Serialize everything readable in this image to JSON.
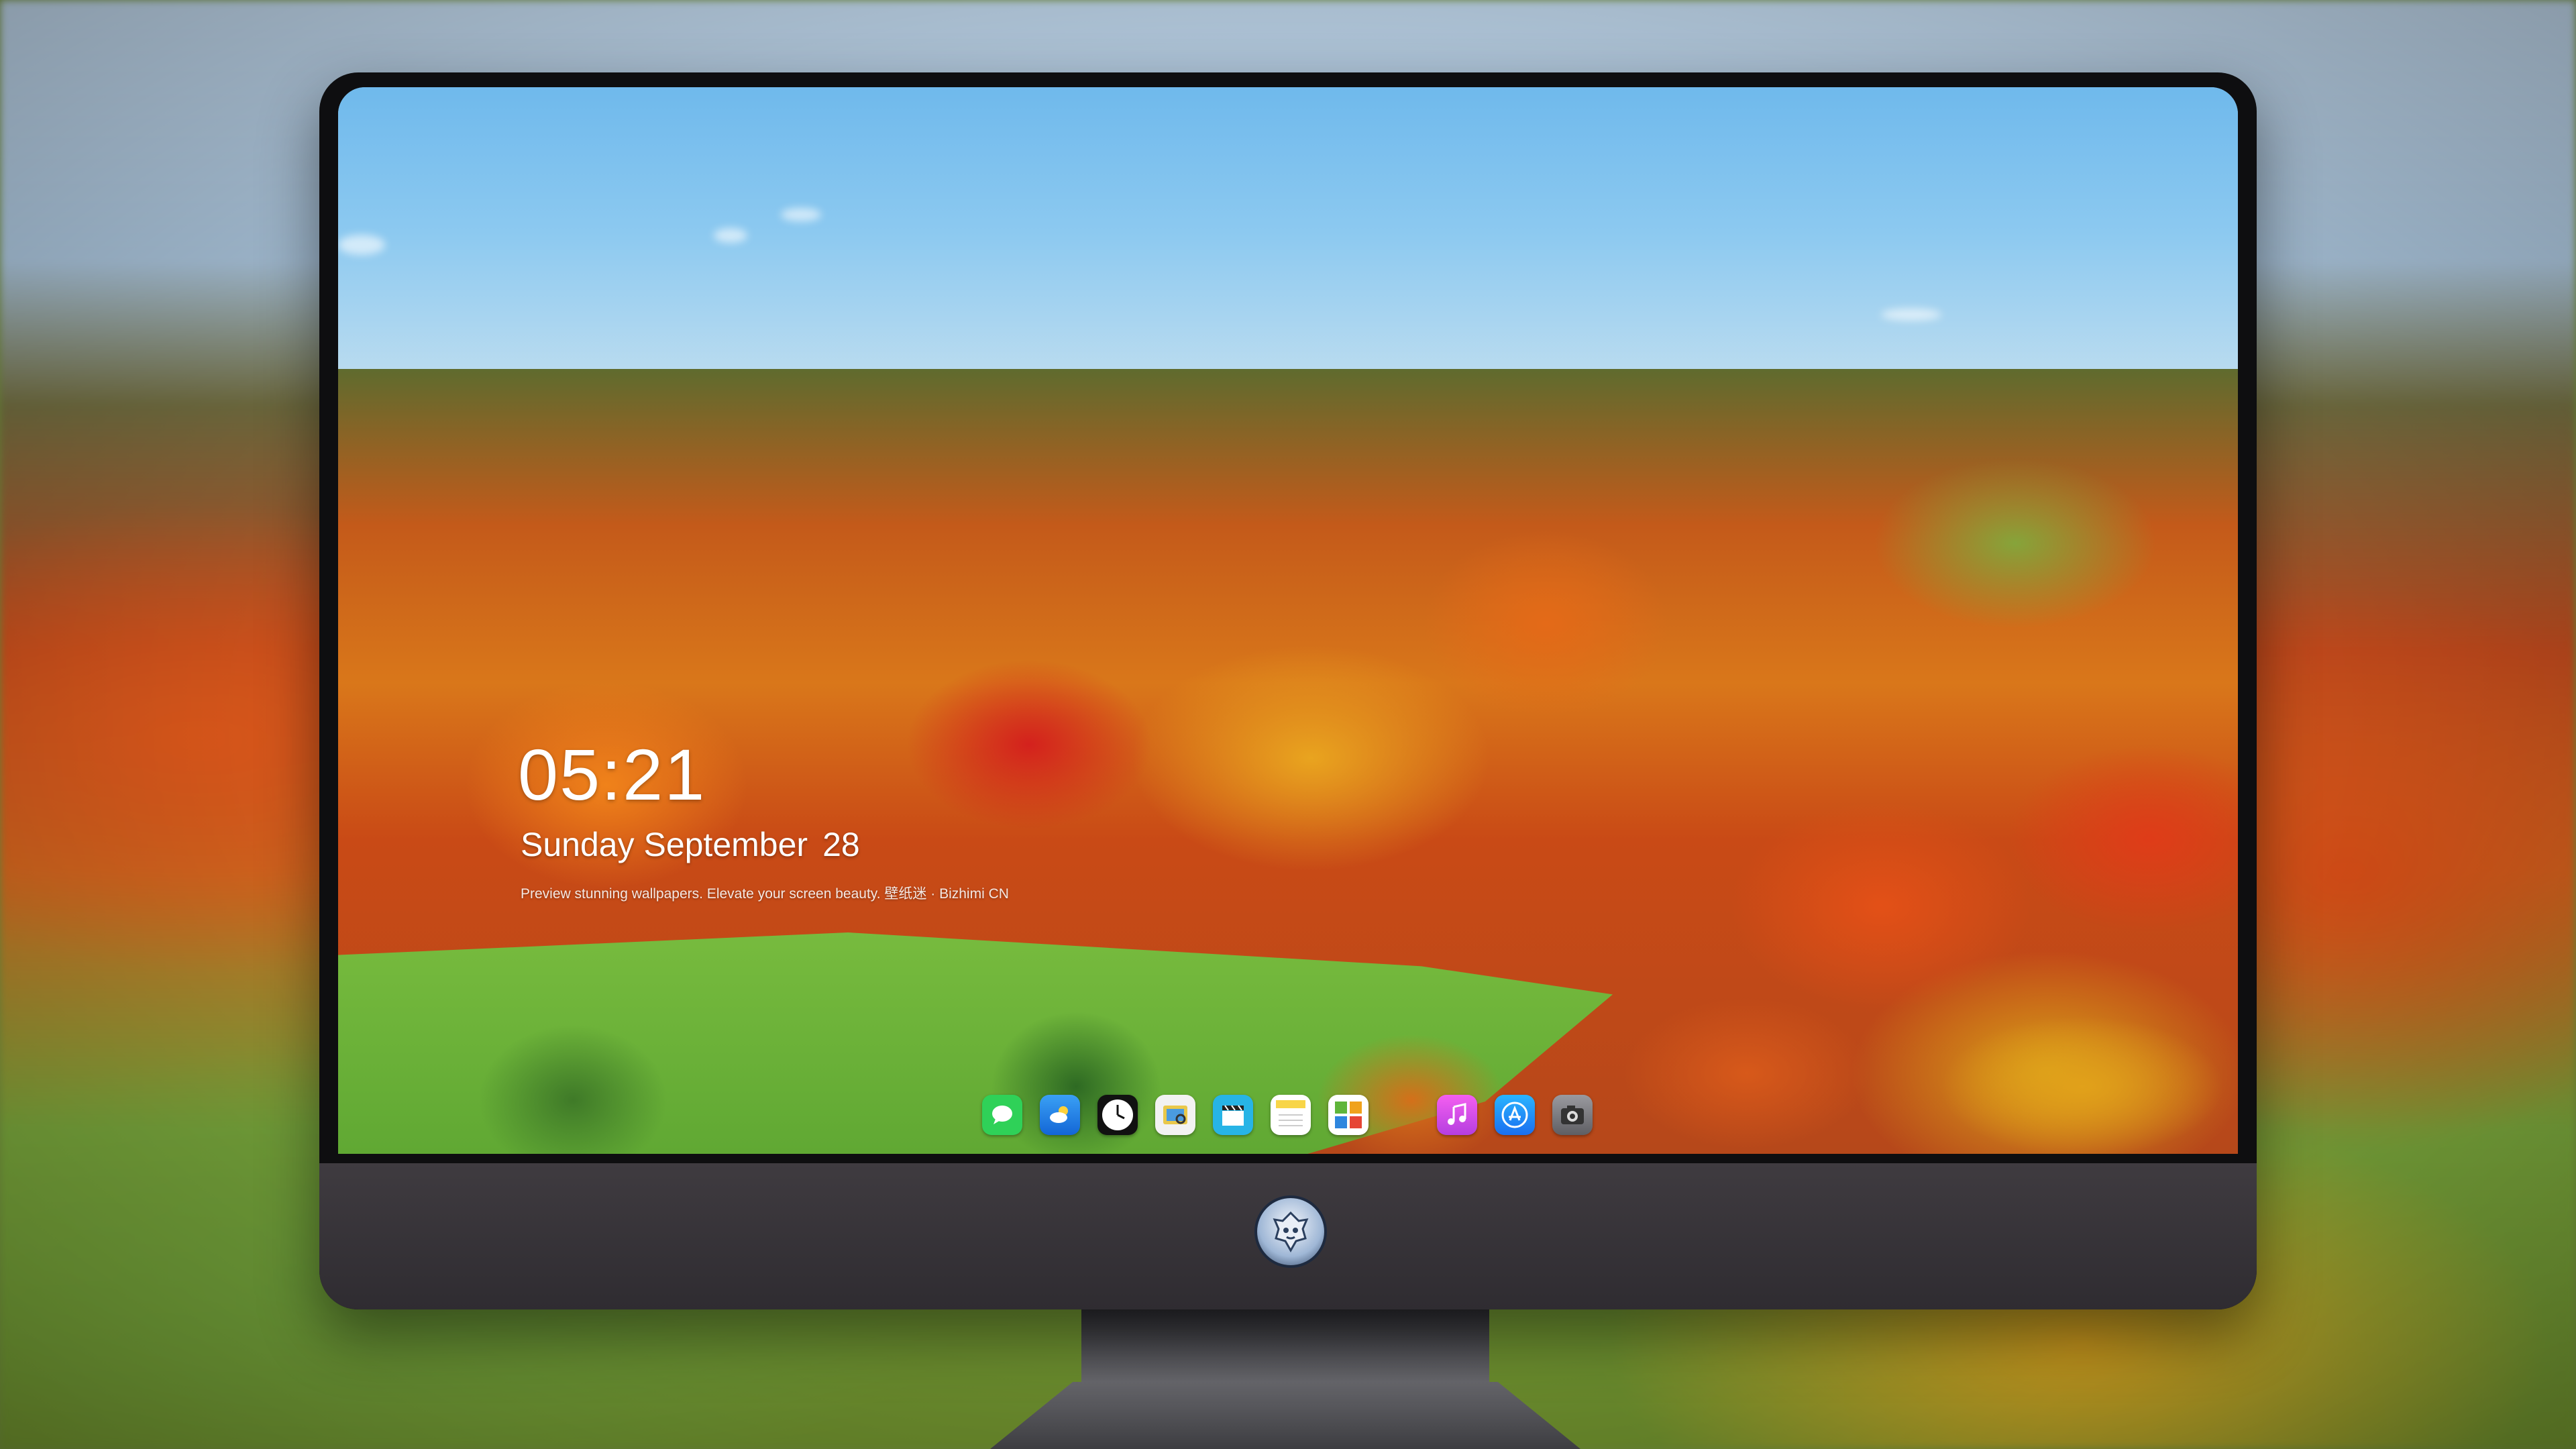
{
  "lock_screen": {
    "time": "05:21",
    "weekday_month": "Sunday September",
    "day": "28",
    "tagline": "Preview stunning wallpapers. Elevate your screen beauty. 壁纸迷 · Bizhimi CN"
  },
  "dock": {
    "apps": [
      {
        "name": "messages",
        "icon": "message-bubble-icon",
        "color": "#2fd158"
      },
      {
        "name": "weather",
        "icon": "cloud-sun-icon",
        "color": "#1e88f0"
      },
      {
        "name": "clock",
        "icon": "clock-icon",
        "color": "#ffffff"
      },
      {
        "name": "preview",
        "icon": "preview-icon",
        "color": "#e9c84a"
      },
      {
        "name": "clips",
        "icon": "clapperboard-icon",
        "color": "#27b4e6"
      },
      {
        "name": "notes",
        "icon": "notes-icon",
        "color": "#f8d548"
      },
      {
        "name": "photo-booth",
        "icon": "photos-icon",
        "color": "#5fb53a"
      },
      {
        "name": "music",
        "icon": "music-note-icon",
        "color": "#e44fe8"
      },
      {
        "name": "app-store",
        "icon": "app-store-icon",
        "color": "#1a8df0"
      },
      {
        "name": "camera",
        "icon": "camera-icon",
        "color": "#8a8a8e"
      }
    ]
  },
  "monitor": {
    "logo": "dragon-mascot-icon"
  }
}
